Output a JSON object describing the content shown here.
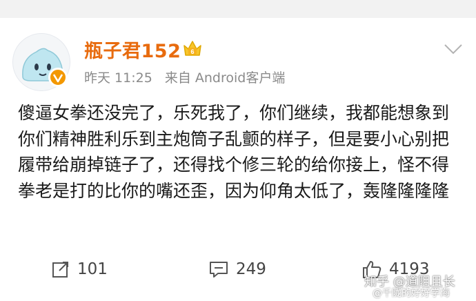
{
  "post": {
    "username": "瓶子君152",
    "time": "昨天 11:25",
    "source": "来自 Android客户端",
    "text": "傻逼女拳还没完了，乐死我了，你们继续，我都能想象到你们精神胜利乐到主炮筒子乱颤的样子，但是要小心别把履带给崩掉链子了，还得找个修三轮的给你接上，怪不得拳老是打的比你的嘴还歪，因为仰角太低了，轰隆隆隆隆"
  },
  "actions": {
    "repost_count": "101",
    "comment_count": "249",
    "like_count": "4193"
  },
  "watermark": {
    "line1": "知乎 @道阻且长",
    "line2": "@千陇的好好学海"
  },
  "colors": {
    "username": "#e86b0e",
    "badge": "#f39800",
    "meta": "#8a8a8a",
    "text": "#1a1a1a"
  }
}
